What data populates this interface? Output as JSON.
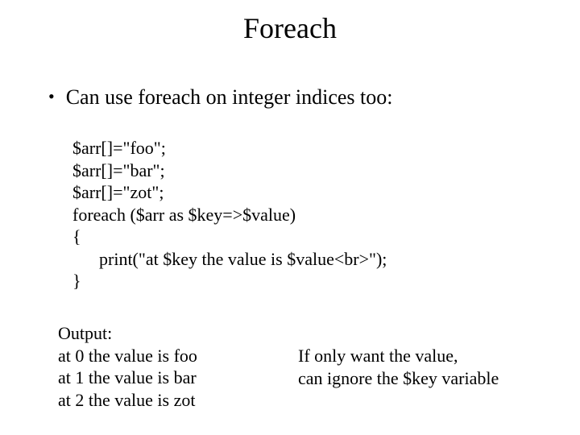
{
  "title": "Foreach",
  "bullet": "Can use foreach on integer indices too:",
  "code": {
    "l1": "$arr[]=\"foo\";",
    "l2": "$arr[]=\"bar\";",
    "l3": "$arr[]=\"zot\";",
    "l4": "foreach ($arr as $key=>$value)",
    "l5": "{",
    "l6": "      print(\"at $key the value is $value<br>\");",
    "l7": "}"
  },
  "output": {
    "label": "Output:",
    "l1": "at 0 the value is foo",
    "l2": "at 1 the value is bar",
    "l3": "at 2 the value is zot"
  },
  "note": {
    "l1": "If only want the value,",
    "l2": "can ignore the $key variable"
  }
}
